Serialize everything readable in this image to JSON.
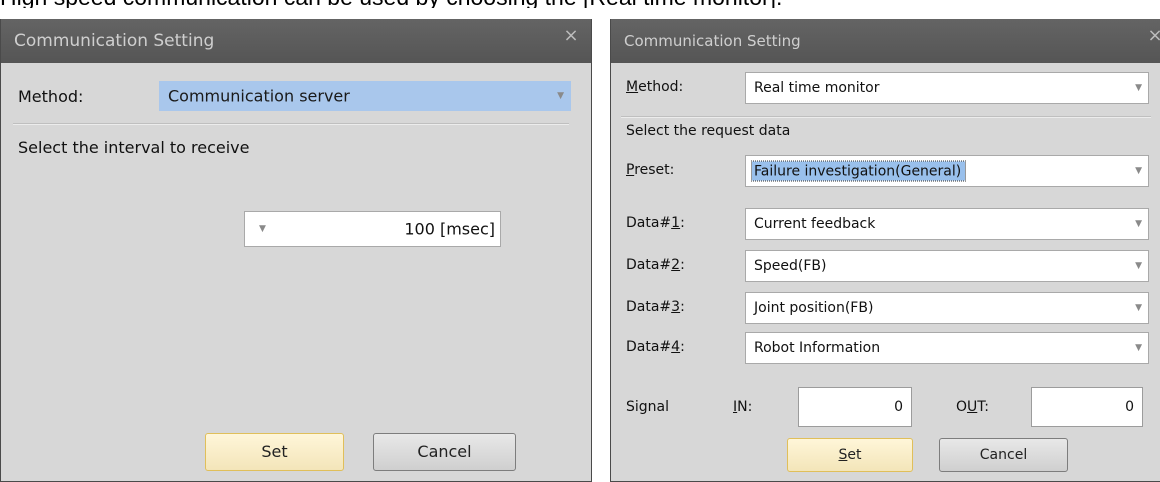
{
  "page_caption": "High speed communication can be used by choosing the [Real time monitor].",
  "left_dialog": {
    "title": "Communication Setting",
    "close_glyph": "×",
    "method_label": "Method:",
    "method_value": "Communication server",
    "interval_prompt": "Select the interval to receive",
    "interval_value": "100 [msec]",
    "set_label": "Set",
    "cancel_label": "Cancel"
  },
  "right_dialog": {
    "title": "Communication Setting",
    "close_glyph": "×",
    "method_label_mnemonic": "M",
    "method_label_rest": "ethod:",
    "method_value": "Real time monitor",
    "request_prompt": "Select the request data",
    "preset_label_mnemonic": "P",
    "preset_label_rest": "reset:",
    "preset_value": "Failure investigation(General)",
    "data_rows": [
      {
        "prefix": "Data#",
        "num": "1",
        "suffix": ":",
        "value": "Current feedback"
      },
      {
        "prefix": "Data#",
        "num": "2",
        "suffix": ":",
        "value": "Speed(FB)"
      },
      {
        "prefix": "Data#",
        "num": "3",
        "suffix": ":",
        "value": "Joint position(FB)"
      },
      {
        "prefix": "Data#",
        "num": "4",
        "suffix": ":",
        "value": "Robot Information"
      }
    ],
    "signal_label": "Signal",
    "in_label_mnemonic": "I",
    "in_label_rest": "N:",
    "in_value": "0",
    "out_label_pre": "O",
    "out_label_mnemonic": "U",
    "out_label_rest": "T:",
    "out_value": "0",
    "set_label_mnemonic": "S",
    "set_label_rest": "et",
    "cancel_label": "Cancel"
  }
}
